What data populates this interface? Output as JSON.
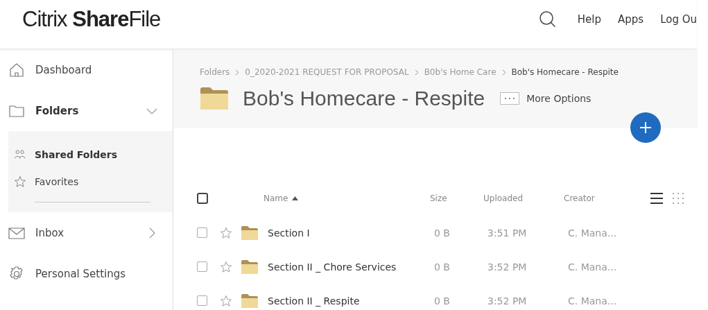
{
  "logo": "Citrix **Share**File",
  "top_nav": [
    "Help",
    "Apps",
    "Log Ou"
  ],
  "sidebar": {
    "items": [
      {
        "kind": "home",
        "label": "Dashboard",
        "selected": false
      },
      {
        "kind": "folder",
        "label": "Folders",
        "selected": false,
        "expanded": true,
        "children": [
          {
            "kind": "people",
            "label": "Shared Folders",
            "selected": true
          },
          {
            "kind": "star",
            "label": "Favorites",
            "selected": false
          }
        ]
      },
      {
        "kind": "mail",
        "label": "Inbox",
        "selected": false,
        "expanded": false
      },
      {
        "kind": "gear",
        "label": "Personal Settings",
        "selected": false
      }
    ]
  },
  "breadcrumb": [
    "Folders",
    "0_2020-2021 REQUEST FOR PROPOSAL",
    "B0b's Home Care",
    "Bob's Homecare - Respite"
  ],
  "folder_title": "Bob's Homecare - Respite",
  "more_options": "More Options",
  "table": {
    "select_all_checked": false,
    "columns": [
      {
        "label": "Name",
        "sorted": true
      },
      {
        "label": "Size",
        "sorted": false
      },
      {
        "label": "Uploaded",
        "sorted": false
      },
      {
        "label": "Creator",
        "sorted": false
      }
    ],
    "views": [
      {
        "kind": "list",
        "selected": true
      },
      {
        "kind": "grid",
        "selected": false
      }
    ],
    "rows": [
      {
        "checked": false,
        "starred": false,
        "name": "Section I",
        "size": "0 B",
        "uploaded": "3:51 PM",
        "creator": "C. Mana..."
      },
      {
        "checked": false,
        "starred": false,
        "name": "Section II _ Chore Services",
        "size": "0 B",
        "uploaded": "3:52 PM",
        "creator": "C. Mana..."
      },
      {
        "checked": false,
        "starred": false,
        "name": "Section II _ Respite",
        "size": "0 B",
        "uploaded": "3:52 PM",
        "creator": "C. Mana..."
      }
    ]
  }
}
